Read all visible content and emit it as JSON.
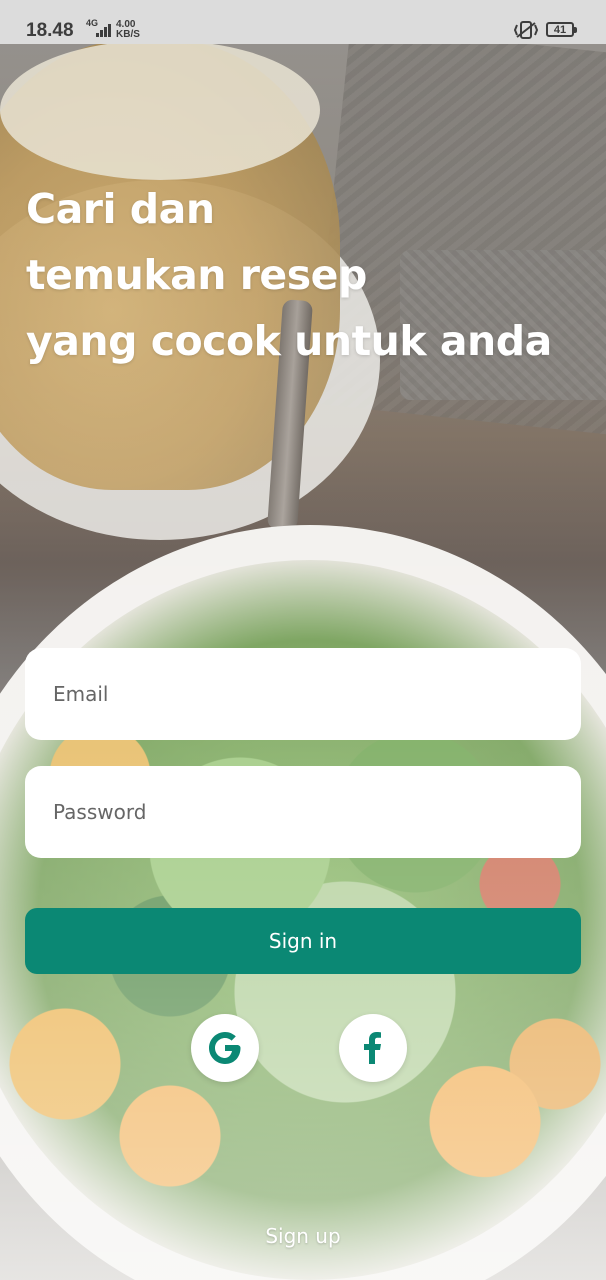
{
  "status_bar": {
    "time": "18.48",
    "network": "4G",
    "speed_value": "4.00",
    "speed_unit": "KB/S",
    "battery": "41",
    "icons": [
      "signal-icon",
      "vibrate-icon",
      "battery-icon"
    ]
  },
  "hero": {
    "line1": "Cari dan",
    "line2": "temukan resep",
    "line3": "yang cocok untuk anda"
  },
  "form": {
    "email_placeholder": "Email",
    "password_placeholder": "Password",
    "signin_label": "Sign in"
  },
  "social": {
    "google_icon": "google-icon",
    "facebook_icon": "facebook-icon"
  },
  "footer": {
    "signup_label": "Sign up"
  },
  "colors": {
    "primary": "#0b8874",
    "field_bg": "#ffffff",
    "text_on_image": "#ffffff"
  }
}
